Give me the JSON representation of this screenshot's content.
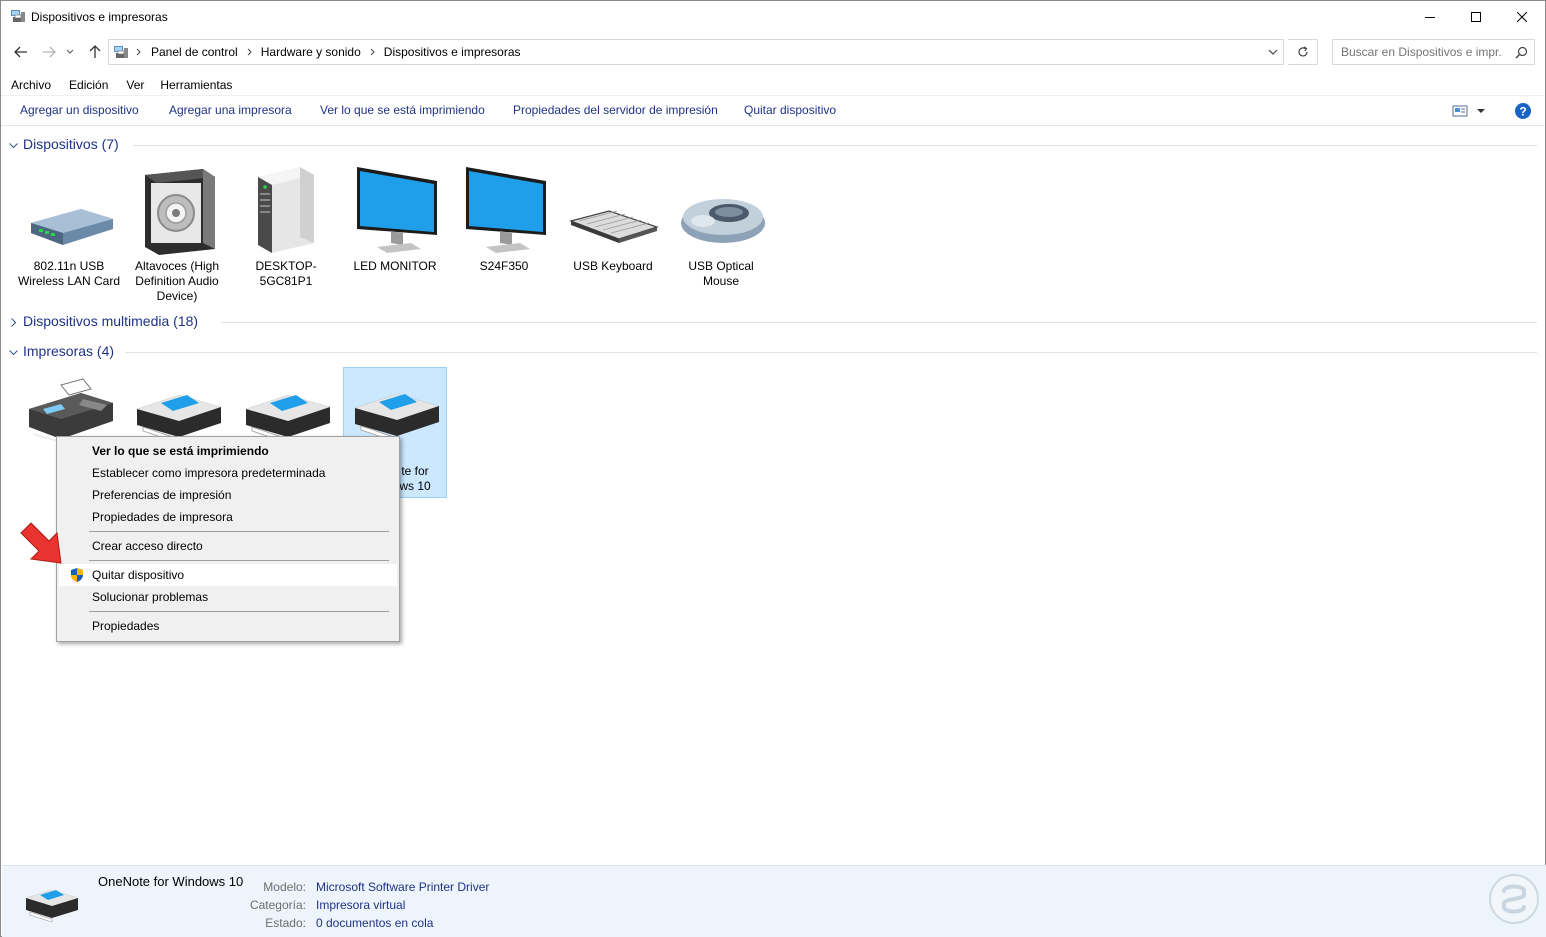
{
  "window": {
    "title": "Dispositivos e impresoras"
  },
  "address": {
    "crumbs": [
      "Panel de control",
      "Hardware y sonido",
      "Dispositivos e impresoras"
    ],
    "search_placeholder": "Buscar en Dispositivos e impr..."
  },
  "menu": [
    "Archivo",
    "Edición",
    "Ver",
    "Herramientas"
  ],
  "commands": [
    "Agregar un dispositivo",
    "Agregar una impresora",
    "Ver lo que se está imprimiendo",
    "Propiedades del servidor de impresión",
    "Quitar dispositivo"
  ],
  "groups": {
    "devices": {
      "title": "Dispositivos (7)"
    },
    "multimedia": {
      "title": "Dispositivos multimedia (18)"
    },
    "printers": {
      "title": "Impresoras (4)"
    }
  },
  "devices": [
    {
      "label": "802.11n USB Wireless LAN Card",
      "icon": "network-adapter-icon"
    },
    {
      "label": "Altavoces (High Definition Audio Device)",
      "icon": "speaker-icon"
    },
    {
      "label": "DESKTOP-5GC81P1",
      "icon": "computer-tower-icon"
    },
    {
      "label": "LED MONITOR",
      "icon": "monitor-icon"
    },
    {
      "label": "S24F350",
      "icon": "monitor-icon"
    },
    {
      "label": "USB Keyboard",
      "icon": "keyboard-icon"
    },
    {
      "label": "USB Optical Mouse",
      "icon": "mouse-icon"
    }
  ],
  "printers": [
    {
      "label": "",
      "icon": "fax-icon"
    },
    {
      "label": "",
      "icon": "printer-icon"
    },
    {
      "label": "",
      "icon": "printer-icon"
    },
    {
      "label": "te for\nws 10",
      "icon": "printer-icon",
      "selected": true
    }
  ],
  "context_menu": {
    "items": [
      "Ver lo que se está imprimiendo",
      "Establecer como impresora predeterminada",
      "Preferencias de impresión",
      "Propiedades de impresora",
      "Crear acceso directo",
      "Quitar dispositivo",
      "Solucionar problemas",
      "Propiedades"
    ]
  },
  "details": {
    "name": "OneNote for Windows 10",
    "fields": [
      {
        "label": "Modelo:",
        "value": "Microsoft Software Printer Driver"
      },
      {
        "label": "Categoría:",
        "value": "Impresora virtual"
      },
      {
        "label": "Estado:",
        "value": "0 documentos en cola"
      }
    ]
  },
  "colors": {
    "link": "#1e3287",
    "selection": "#cce8ff",
    "accent_red": "#e8332e"
  }
}
